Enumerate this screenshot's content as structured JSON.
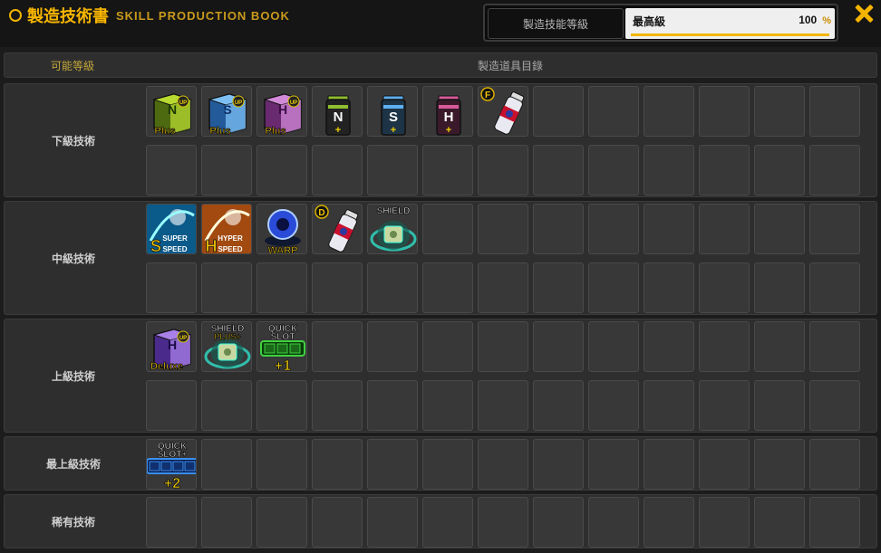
{
  "window": {
    "title_cn": "製造技術書",
    "title_en": "SKILL PRODUCTION BOOK"
  },
  "level": {
    "label": "製造技能等級",
    "value_name": "最高級",
    "value": "100",
    "unit": "%",
    "progress": 1.0
  },
  "columns": {
    "level": "可能等級",
    "items": "製造道具目錄"
  },
  "groups": [
    {
      "label": "下級技術",
      "rows": 2,
      "items": [
        {
          "icon": "nitro-plus-box-green-icon",
          "text_top": "N",
          "badge": "UP",
          "text_bottom": "Plus"
        },
        {
          "icon": "shield-plus-box-blue-icon",
          "text_top": "S",
          "badge": "UP",
          "text_bottom": "Plus"
        },
        {
          "icon": "hyper-plus-box-pink-icon",
          "text_top": "H",
          "badge": "UP",
          "text_bottom": "Plus"
        },
        {
          "icon": "nitro-bottle-icon",
          "text_top": "N",
          "text_bottom": "+"
        },
        {
          "icon": "speed-bottle-icon",
          "text_top": "S",
          "text_bottom": "+"
        },
        {
          "icon": "hyper-bottle-icon",
          "text_top": "H",
          "text_bottom": "+"
        },
        {
          "icon": "f-grade-spray-can-icon",
          "badge": "F"
        }
      ]
    },
    {
      "label": "中級技術",
      "rows": 2,
      "items": [
        {
          "icon": "super-speed-icon",
          "text_top": "SUPER",
          "text_bottom": "SPEED"
        },
        {
          "icon": "hyper-speed-icon",
          "text_top": "HYPER",
          "text_bottom": "SPEED"
        },
        {
          "icon": "warp-icon",
          "text_bottom": "WARP"
        },
        {
          "icon": "d-grade-spray-can-icon",
          "badge": "D"
        },
        {
          "icon": "shield-icon",
          "text_top": "SHIELD"
        }
      ]
    },
    {
      "label": "上級技術",
      "rows": 2,
      "items": [
        {
          "icon": "deluxe-box-purple-icon",
          "text_top": "H",
          "badge": "UP",
          "text_bottom": "Deluxe"
        },
        {
          "icon": "shield-plus-icon",
          "text_top": "SHIELD",
          "text_mid": "PLUS+"
        },
        {
          "icon": "quick-slot-plus-1-icon",
          "text_top": "QUICK",
          "text_mid": "SLOT",
          "text_bottom": "+1"
        }
      ]
    },
    {
      "label": "最上級技術",
      "rows": 1,
      "items": [
        {
          "icon": "quick-slot-plus-2-icon",
          "text_top": "QUICK",
          "text_mid": "SLOT+",
          "text_bottom": "+2"
        }
      ]
    },
    {
      "label": "稀有技術",
      "rows": 1,
      "items": []
    }
  ]
}
